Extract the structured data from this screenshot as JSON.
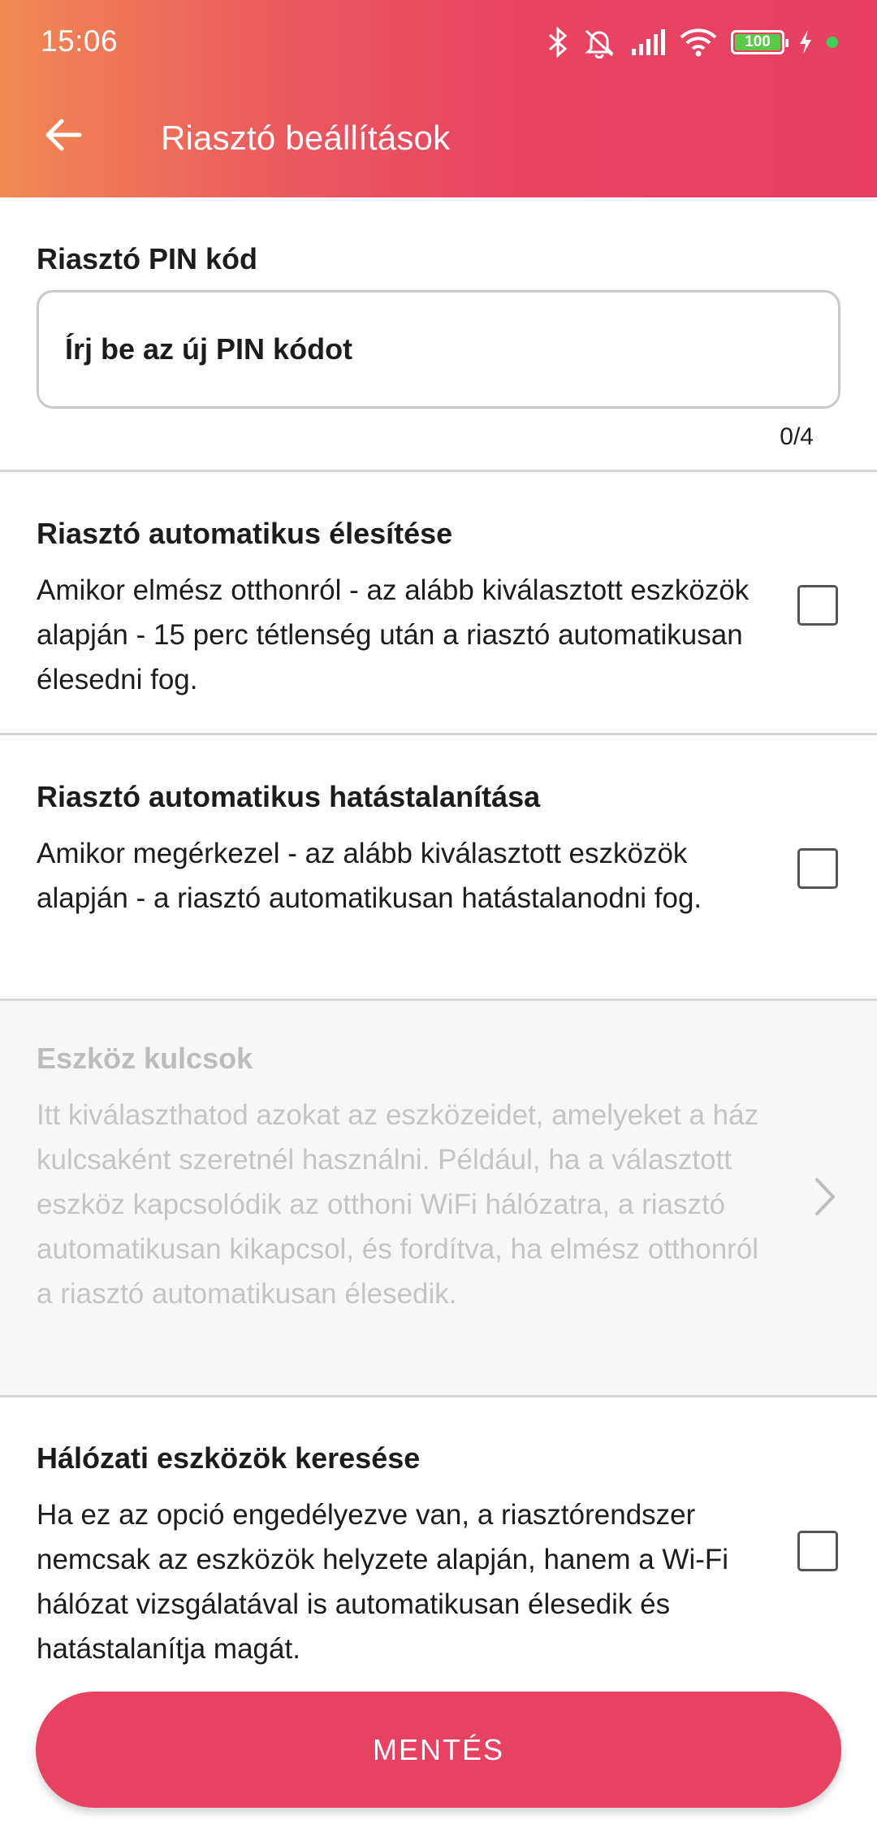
{
  "status_bar": {
    "time": "15:06",
    "battery_level": "100",
    "icons": [
      "bluetooth-icon",
      "mute-icon",
      "signal-icon",
      "wifi-icon",
      "battery-icon",
      "charging-icon",
      "camera-dot-icon"
    ]
  },
  "header": {
    "back_icon": "arrow-left-icon",
    "title": "Riasztó beállítások"
  },
  "pin": {
    "label": "Riasztó PIN kód",
    "placeholder": "Írj be az új PIN kódot",
    "value": "",
    "counter": "0/4"
  },
  "options": [
    {
      "title": "Riasztó automatikus élesítése",
      "description": "Amikor elmész otthonról - az alább kiválasztott eszközök alapján - 15 perc tétlenség után a riasztó automatikusan élesedni fog.",
      "checked": false
    },
    {
      "title": "Riasztó automatikus hatástalanítása",
      "description": "Amikor megérkezel - az alább kiválasztott eszközök alapján - a riasztó automatikusan hatástalanodni fog.",
      "checked": false
    },
    {
      "title": "Eszköz kulcsok",
      "description": "Itt kiválaszthatod azokat az eszközeidet, amelyeket a ház kulcsaként szeretnél használni. Például, ha a választott eszköz kapcsolódik az otthoni WiFi hálózatra, a riasztó automatikusan kikapcsol, és fordítva, ha elmész otthonról a riasztó automatikusan élesedik.",
      "disabled": true,
      "icon": "chevron-right-icon"
    },
    {
      "title": "Hálózati eszközök keresése",
      "description": "Ha ez az opció engedélyezve van, a riasztórendszer nemcsak az eszközök helyzete alapján, hanem a Wi-Fi hálózat vizsgálatával is automatikusan élesedik és hatástalanítja magát.",
      "checked": false
    }
  ],
  "footer": {
    "save_label": "MENTÉS"
  },
  "colors": {
    "accent": "#e84263",
    "gradient_start": "#f08a52",
    "gradient_end": "#e83f62",
    "disabled_text": "#c4c4c4"
  }
}
